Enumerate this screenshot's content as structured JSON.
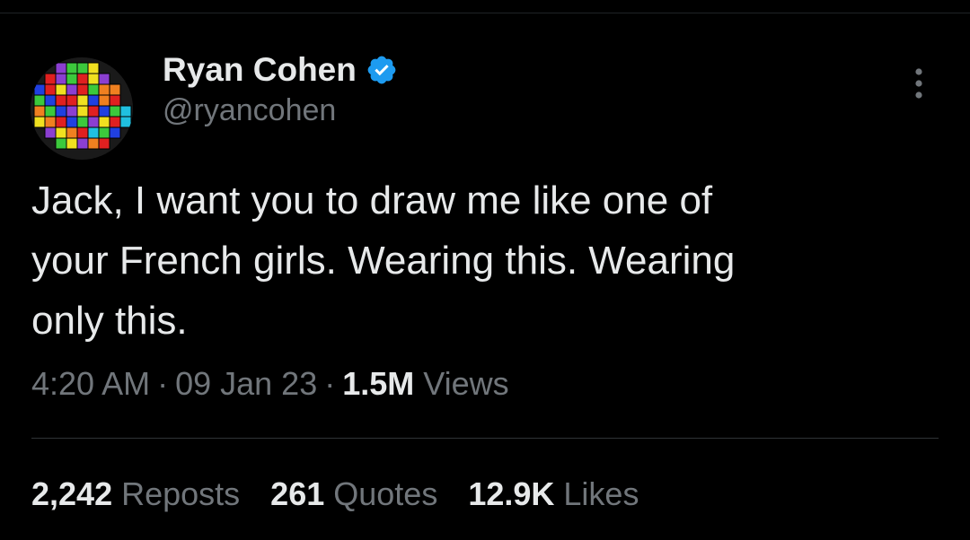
{
  "tweet": {
    "author": {
      "display_name": "Ryan Cohen",
      "handle": "@ryancohen",
      "verified": true,
      "avatar_icon": "tetris-blocks-avatar"
    },
    "menu_icon": "more-options-icon",
    "text": "Jack, I want you to draw me like one of\nyour French girls. Wearing this. Wearing\nonly this.",
    "time": "4:20 AM",
    "date": "09 Jan 23",
    "separator": "·",
    "views_count": "1.5M",
    "views_label": "Views",
    "stats": [
      {
        "count": "2,242",
        "label": "Reposts"
      },
      {
        "count": "261",
        "label": "Quotes"
      },
      {
        "count": "12.9K",
        "label": "Likes"
      }
    ]
  },
  "colors": {
    "background": "#000000",
    "primary_text": "#e7e9ea",
    "secondary_text": "#71767b",
    "divider": "#2f3336",
    "verified_badge": "#1d9bf0"
  }
}
